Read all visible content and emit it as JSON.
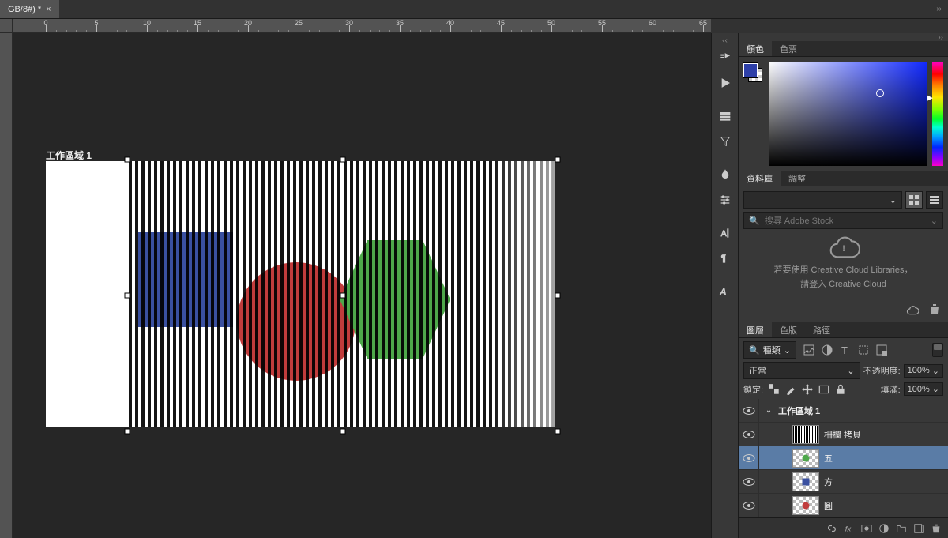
{
  "document": {
    "tab_title": "GB/8#) *"
  },
  "ruler": {
    "ticks": [
      "0",
      "5",
      "10",
      "15",
      "20",
      "25",
      "30",
      "35",
      "40",
      "45",
      "50",
      "55",
      "60",
      "65"
    ]
  },
  "canvas": {
    "artboard_label": "工作區域 1"
  },
  "color_panel": {
    "tabs": {
      "color": "顏色",
      "swatches": "色票"
    },
    "foreground_hex": "#2d3fa8"
  },
  "libraries_panel": {
    "tabs": {
      "libraries": "資料庫",
      "adjustments": "調整"
    },
    "search_placeholder": "搜尋 Adobe Stock",
    "msg_line1": "若要使用 Creative Cloud Libraries，",
    "msg_line2": "請登入 Creative Cloud"
  },
  "layers_panel": {
    "tabs": {
      "layers": "圖層",
      "channels": "色版",
      "paths": "路徑"
    },
    "kind_label": "種類",
    "blend_mode": "正常",
    "opacity_label": "不透明度:",
    "opacity_value": "100%",
    "lock_label": "鎖定:",
    "fill_label": "填滿:",
    "fill_value": "100%",
    "search_icon_label": "🔍",
    "layers": [
      {
        "name": "工作區域 1",
        "kind": "artboard"
      },
      {
        "name": "柵欄 拷貝",
        "kind": "stripes"
      },
      {
        "name": "五",
        "kind": "green",
        "selected": true
      },
      {
        "name": "方",
        "kind": "blue"
      },
      {
        "name": "圓",
        "kind": "red"
      }
    ]
  }
}
